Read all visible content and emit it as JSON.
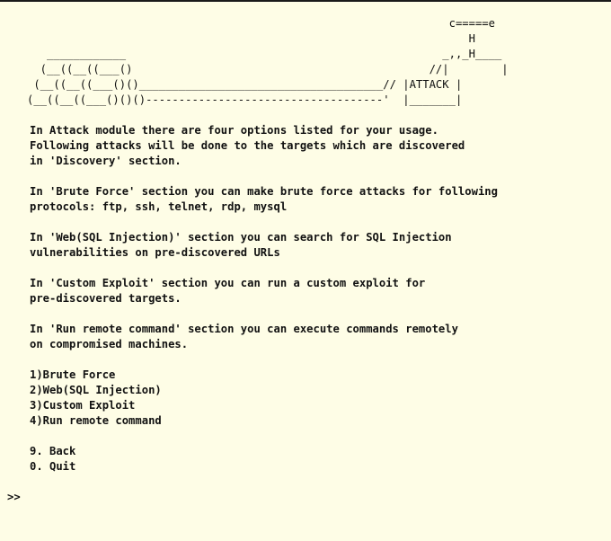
{
  "banner": {
    "art": "                                                                   c=====e\n                                                                      H\n      ____________                                                _,,_H____\n     (__((__((___()                                             //|        |\n    (__((__((___()()_____________________________________// |ATTACK |\n   (__((__((___()()()------------------------------------'  |_______|"
  },
  "intro": {
    "line1": "In Attack module there are four options listed for your usage.",
    "line2": "Following attacks will be done to the targets which are discovered",
    "line3": "in 'Discovery' section."
  },
  "sections": [
    {
      "line1": "In 'Brute Force' section you can make brute force attacks for following",
      "line2": "protocols: ftp, ssh, telnet, rdp, mysql"
    },
    {
      "line1": "In 'Web(SQL Injection)' section you can search for SQL Injection",
      "line2": "vulnerabilities on pre-discovered URLs"
    },
    {
      "line1": "In 'Custom Exploit' section you can run a custom exploit for",
      "line2": "pre-discovered targets."
    },
    {
      "line1": "In 'Run remote command' section you can execute commands remotely",
      "line2": "on compromised machines."
    }
  ],
  "menu": {
    "options": [
      "1)Brute Force",
      "2)Web(SQL Injection)",
      "3)Custom Exploit",
      "4)Run remote command"
    ],
    "back": "9. Back",
    "quit": "0. Quit"
  },
  "prompt": {
    "symbol": ">>",
    "value": ""
  },
  "colors": {
    "background": "#fefde6",
    "text": "#111111",
    "top_border": "#1a1a1a"
  }
}
